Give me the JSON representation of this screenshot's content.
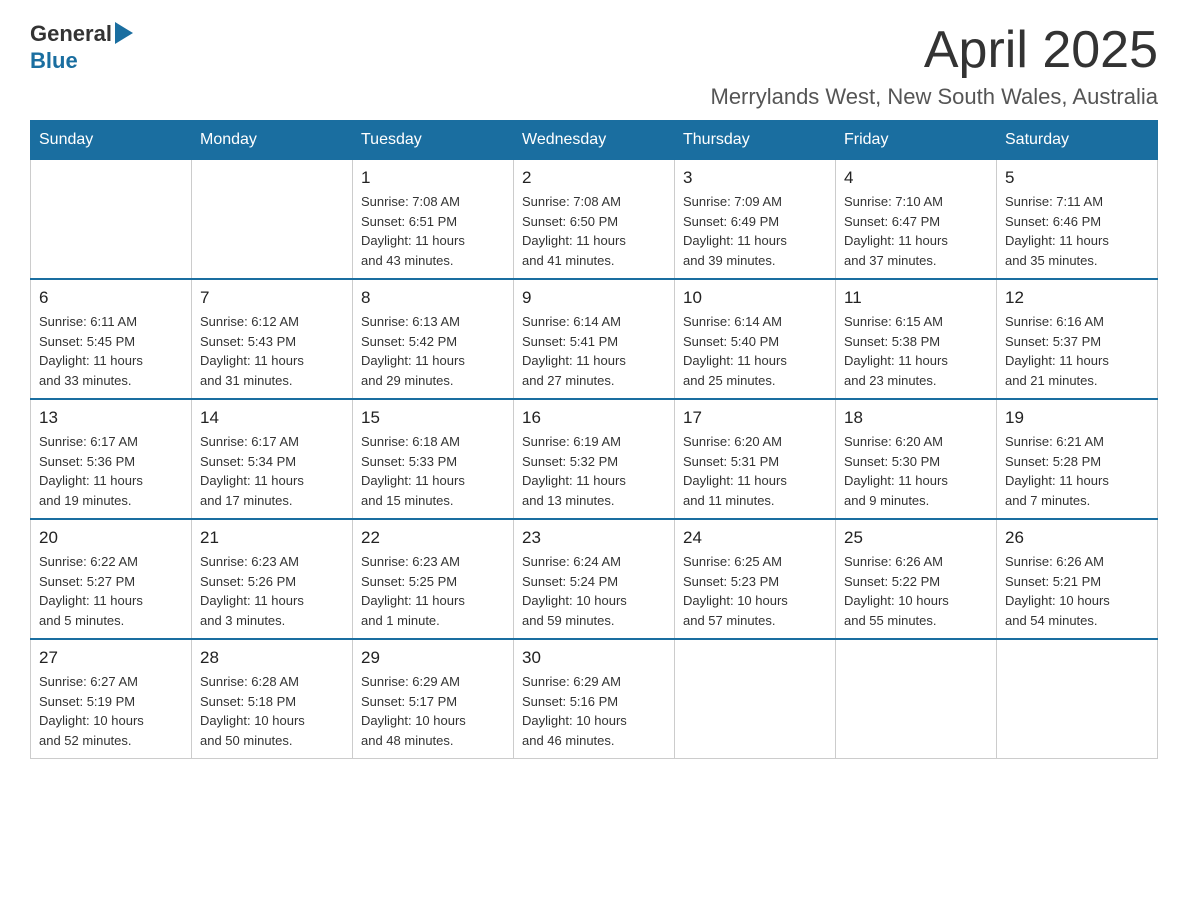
{
  "logo": {
    "text_general": "General",
    "text_blue": "Blue"
  },
  "title": "April 2025",
  "location": "Merrylands West, New South Wales, Australia",
  "days_of_week": [
    "Sunday",
    "Monday",
    "Tuesday",
    "Wednesday",
    "Thursday",
    "Friday",
    "Saturday"
  ],
  "weeks": [
    [
      {
        "day": "",
        "info": ""
      },
      {
        "day": "",
        "info": ""
      },
      {
        "day": "1",
        "info": "Sunrise: 7:08 AM\nSunset: 6:51 PM\nDaylight: 11 hours\nand 43 minutes."
      },
      {
        "day": "2",
        "info": "Sunrise: 7:08 AM\nSunset: 6:50 PM\nDaylight: 11 hours\nand 41 minutes."
      },
      {
        "day": "3",
        "info": "Sunrise: 7:09 AM\nSunset: 6:49 PM\nDaylight: 11 hours\nand 39 minutes."
      },
      {
        "day": "4",
        "info": "Sunrise: 7:10 AM\nSunset: 6:47 PM\nDaylight: 11 hours\nand 37 minutes."
      },
      {
        "day": "5",
        "info": "Sunrise: 7:11 AM\nSunset: 6:46 PM\nDaylight: 11 hours\nand 35 minutes."
      }
    ],
    [
      {
        "day": "6",
        "info": "Sunrise: 6:11 AM\nSunset: 5:45 PM\nDaylight: 11 hours\nand 33 minutes."
      },
      {
        "day": "7",
        "info": "Sunrise: 6:12 AM\nSunset: 5:43 PM\nDaylight: 11 hours\nand 31 minutes."
      },
      {
        "day": "8",
        "info": "Sunrise: 6:13 AM\nSunset: 5:42 PM\nDaylight: 11 hours\nand 29 minutes."
      },
      {
        "day": "9",
        "info": "Sunrise: 6:14 AM\nSunset: 5:41 PM\nDaylight: 11 hours\nand 27 minutes."
      },
      {
        "day": "10",
        "info": "Sunrise: 6:14 AM\nSunset: 5:40 PM\nDaylight: 11 hours\nand 25 minutes."
      },
      {
        "day": "11",
        "info": "Sunrise: 6:15 AM\nSunset: 5:38 PM\nDaylight: 11 hours\nand 23 minutes."
      },
      {
        "day": "12",
        "info": "Sunrise: 6:16 AM\nSunset: 5:37 PM\nDaylight: 11 hours\nand 21 minutes."
      }
    ],
    [
      {
        "day": "13",
        "info": "Sunrise: 6:17 AM\nSunset: 5:36 PM\nDaylight: 11 hours\nand 19 minutes."
      },
      {
        "day": "14",
        "info": "Sunrise: 6:17 AM\nSunset: 5:34 PM\nDaylight: 11 hours\nand 17 minutes."
      },
      {
        "day": "15",
        "info": "Sunrise: 6:18 AM\nSunset: 5:33 PM\nDaylight: 11 hours\nand 15 minutes."
      },
      {
        "day": "16",
        "info": "Sunrise: 6:19 AM\nSunset: 5:32 PM\nDaylight: 11 hours\nand 13 minutes."
      },
      {
        "day": "17",
        "info": "Sunrise: 6:20 AM\nSunset: 5:31 PM\nDaylight: 11 hours\nand 11 minutes."
      },
      {
        "day": "18",
        "info": "Sunrise: 6:20 AM\nSunset: 5:30 PM\nDaylight: 11 hours\nand 9 minutes."
      },
      {
        "day": "19",
        "info": "Sunrise: 6:21 AM\nSunset: 5:28 PM\nDaylight: 11 hours\nand 7 minutes."
      }
    ],
    [
      {
        "day": "20",
        "info": "Sunrise: 6:22 AM\nSunset: 5:27 PM\nDaylight: 11 hours\nand 5 minutes."
      },
      {
        "day": "21",
        "info": "Sunrise: 6:23 AM\nSunset: 5:26 PM\nDaylight: 11 hours\nand 3 minutes."
      },
      {
        "day": "22",
        "info": "Sunrise: 6:23 AM\nSunset: 5:25 PM\nDaylight: 11 hours\nand 1 minute."
      },
      {
        "day": "23",
        "info": "Sunrise: 6:24 AM\nSunset: 5:24 PM\nDaylight: 10 hours\nand 59 minutes."
      },
      {
        "day": "24",
        "info": "Sunrise: 6:25 AM\nSunset: 5:23 PM\nDaylight: 10 hours\nand 57 minutes."
      },
      {
        "day": "25",
        "info": "Sunrise: 6:26 AM\nSunset: 5:22 PM\nDaylight: 10 hours\nand 55 minutes."
      },
      {
        "day": "26",
        "info": "Sunrise: 6:26 AM\nSunset: 5:21 PM\nDaylight: 10 hours\nand 54 minutes."
      }
    ],
    [
      {
        "day": "27",
        "info": "Sunrise: 6:27 AM\nSunset: 5:19 PM\nDaylight: 10 hours\nand 52 minutes."
      },
      {
        "day": "28",
        "info": "Sunrise: 6:28 AM\nSunset: 5:18 PM\nDaylight: 10 hours\nand 50 minutes."
      },
      {
        "day": "29",
        "info": "Sunrise: 6:29 AM\nSunset: 5:17 PM\nDaylight: 10 hours\nand 48 minutes."
      },
      {
        "day": "30",
        "info": "Sunrise: 6:29 AM\nSunset: 5:16 PM\nDaylight: 10 hours\nand 46 minutes."
      },
      {
        "day": "",
        "info": ""
      },
      {
        "day": "",
        "info": ""
      },
      {
        "day": "",
        "info": ""
      }
    ]
  ]
}
